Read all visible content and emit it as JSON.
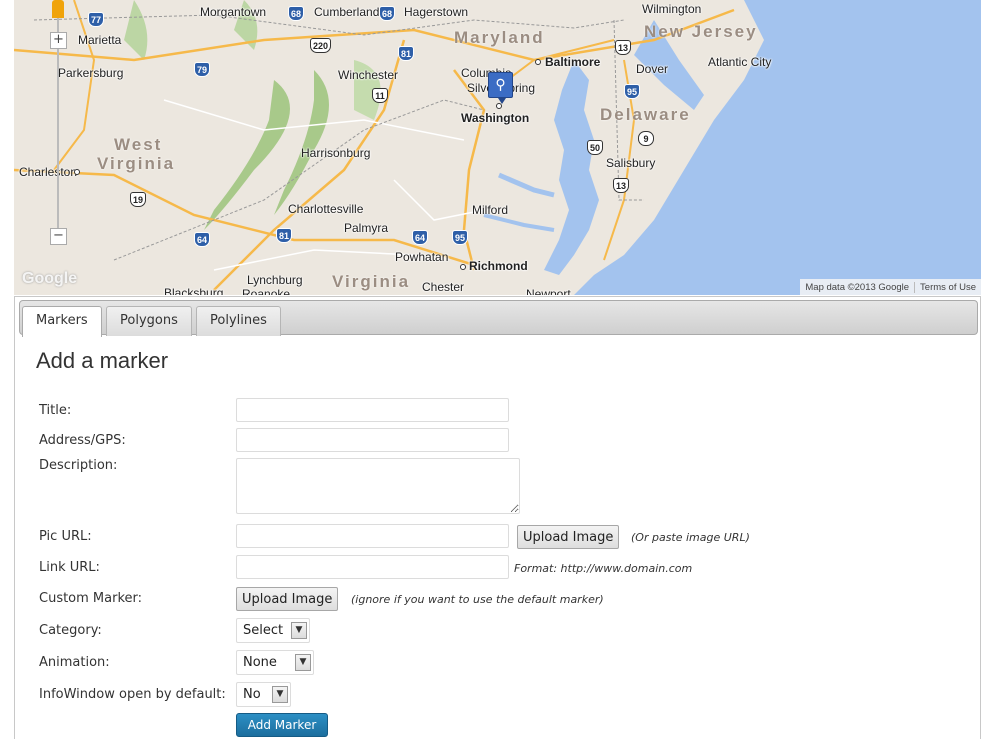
{
  "map": {
    "cities": [
      {
        "name": "Morgantown"
      },
      {
        "name": "Cumberland"
      },
      {
        "name": "Hagerstown"
      },
      {
        "name": "Wilmington"
      },
      {
        "name": "Marietta"
      },
      {
        "name": "Parkersburg"
      },
      {
        "name": "Winchester"
      },
      {
        "name": "Columbia"
      },
      {
        "name": "Baltimore"
      },
      {
        "name": "Dover"
      },
      {
        "name": "Atlantic City"
      },
      {
        "name": "Silver Spring"
      },
      {
        "name": "Washington"
      },
      {
        "name": "Charleston"
      },
      {
        "name": "Harrisonburg"
      },
      {
        "name": "Salisbury"
      },
      {
        "name": "Charlottesville"
      },
      {
        "name": "Milford"
      },
      {
        "name": "Palmyra"
      },
      {
        "name": "Powhatan"
      },
      {
        "name": "Richmond"
      },
      {
        "name": "Lynchburg"
      },
      {
        "name": "Blacksburg"
      },
      {
        "name": "Roanoke"
      },
      {
        "name": "Chester"
      },
      {
        "name": "Newport"
      }
    ],
    "states": [
      "Maryland",
      "New Jersey",
      "West",
      "Virginia",
      "Delaware",
      "Virginia"
    ],
    "highways": [
      "77",
      "68",
      "68",
      "220",
      "81",
      "79",
      "11",
      "13",
      "95",
      "50",
      "9",
      "13",
      "19",
      "81",
      "64",
      "64",
      "95"
    ],
    "zoom_in": "+",
    "zoom_out": "−",
    "logo": "Google",
    "attribution": "Map data ©2013 Google",
    "terms": "Terms of Use",
    "colors": {
      "water": "#a3c3ee",
      "land": "#ece7df",
      "park": "#a8c98a",
      "road": "#f6b94a"
    }
  },
  "tabs": [
    {
      "label": "Markers",
      "active": true
    },
    {
      "label": "Polygons",
      "active": false
    },
    {
      "label": "Polylines",
      "active": false
    }
  ],
  "form": {
    "title": "Add a marker",
    "fields": {
      "title": {
        "label": "Title:",
        "value": ""
      },
      "address": {
        "label": "Address/GPS:",
        "value": ""
      },
      "description": {
        "label": "Description:",
        "value": ""
      },
      "pic_url": {
        "label": "Pic URL:",
        "value": "",
        "upload_label": "Upload Image",
        "hint": "(Or paste image URL)"
      },
      "link_url": {
        "label": "Link URL:",
        "value": "",
        "hint": "Format: http://www.domain.com"
      },
      "custom_marker": {
        "label": "Custom Marker:",
        "upload_label": "Upload Image",
        "hint": "(ignore if you want to use the default marker)"
      },
      "category": {
        "label": "Category:",
        "selected": "Select"
      },
      "animation": {
        "label": "Animation:",
        "selected": "None"
      },
      "infowindow": {
        "label": "InfoWindow open by default:",
        "selected": "No"
      }
    },
    "submit_label": "Add Marker",
    "colors": {
      "accent": "#1f77ab"
    }
  }
}
